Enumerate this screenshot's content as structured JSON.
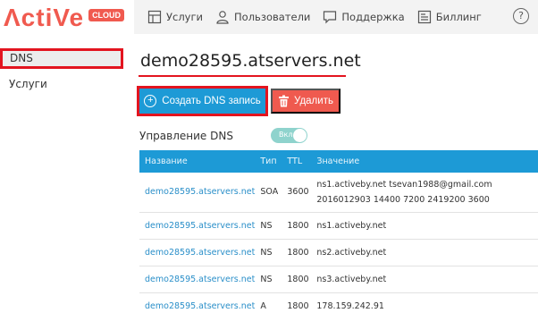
{
  "brand": {
    "logo_text": "ΛctiVe",
    "badge": "CLOUD"
  },
  "sidebar": {
    "items": [
      {
        "label": "DNS"
      },
      {
        "label": "Услуги"
      }
    ]
  },
  "topnav": {
    "items": [
      {
        "label": "Услуги",
        "icon": "services-icon"
      },
      {
        "label": "Пользователи",
        "icon": "users-icon"
      },
      {
        "label": "Поддержка",
        "icon": "support-icon"
      },
      {
        "label": "Биллинг",
        "icon": "billing-icon"
      }
    ],
    "help": "?"
  },
  "main": {
    "title": "demo28595.atservers.net",
    "create_button": "Создать DNS запись",
    "delete_button": "Удалить",
    "dns_management_label": "Управление DNS",
    "dns_toggle_label": "Вкл"
  },
  "table": {
    "columns": [
      "Название",
      "Тип",
      "TTL",
      "Значение"
    ],
    "rows": [
      {
        "name": "demo28595.atservers.net",
        "type": "SOA",
        "ttl": "3600",
        "value": "ns1.activeby.net tsevan1988@gmail.com 2016012903 14400 7200 2419200 3600"
      },
      {
        "name": "demo28595.atservers.net",
        "type": "NS",
        "ttl": "1800",
        "value": "ns1.activeby.net"
      },
      {
        "name": "demo28595.atservers.net",
        "type": "NS",
        "ttl": "1800",
        "value": "ns2.activeby.net"
      },
      {
        "name": "demo28595.atservers.net",
        "type": "NS",
        "ttl": "1800",
        "value": "ns3.activeby.net"
      },
      {
        "name": "demo28595.atservers.net",
        "type": "A",
        "ttl": "1800",
        "value": "178.159.242.91"
      }
    ]
  },
  "colors": {
    "accent": "#1d9ad6",
    "danger": "#ef5a4f",
    "brand": "#f05a4f",
    "highlight": "#e3141f"
  }
}
